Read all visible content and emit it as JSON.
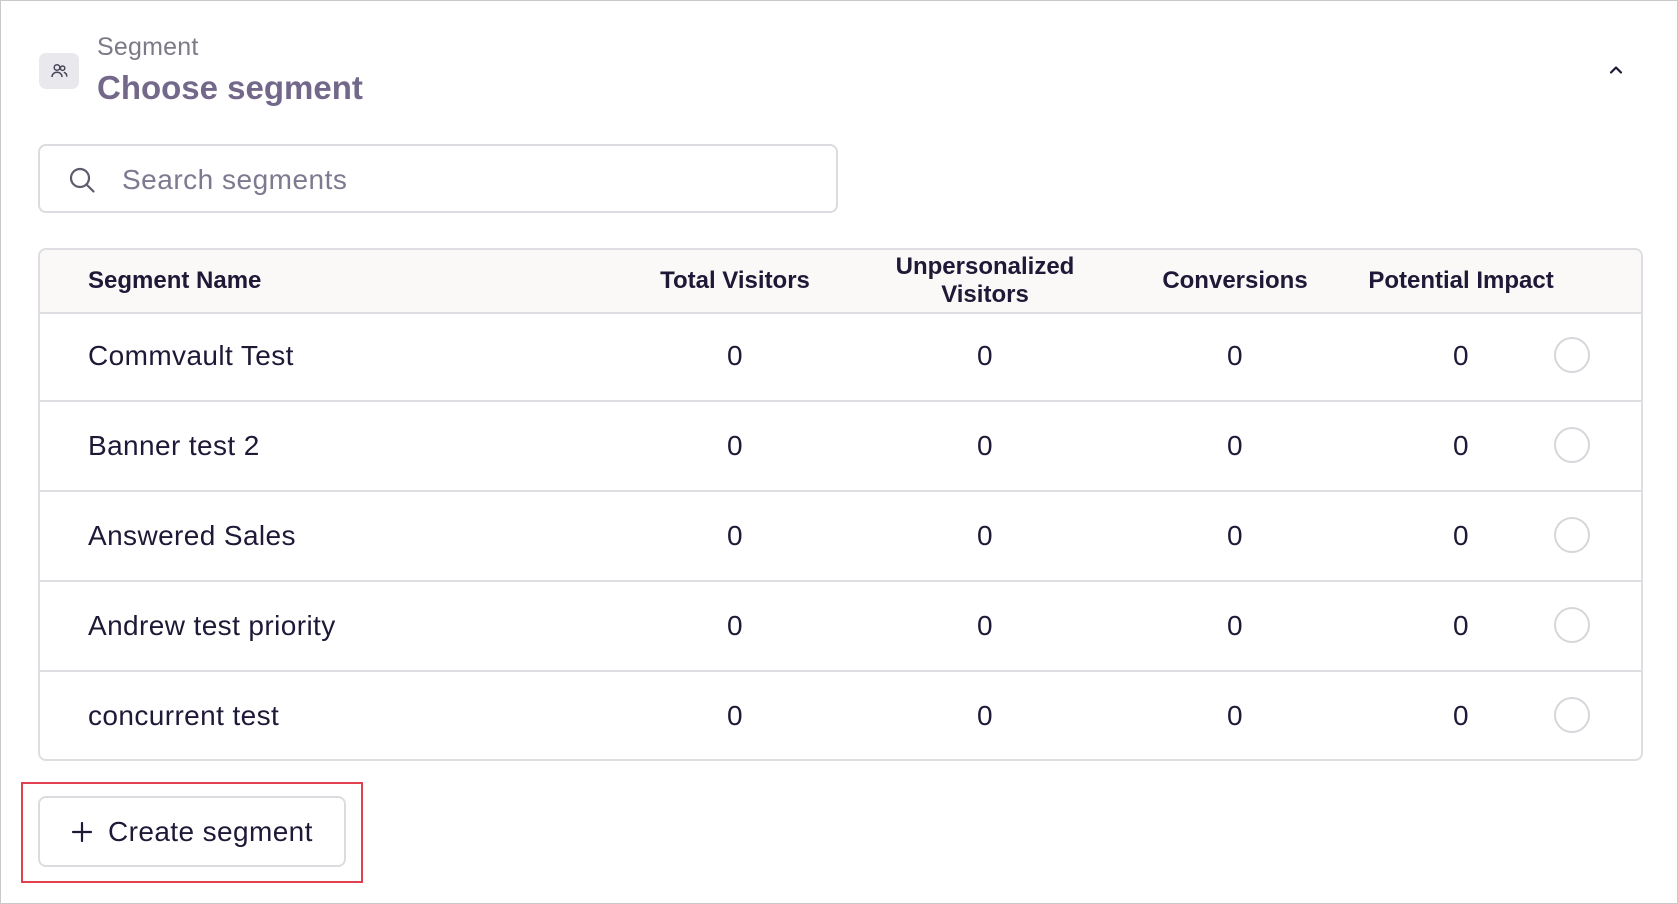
{
  "header": {
    "subtitle": "Segment",
    "title": "Choose segment",
    "icon": "users-icon",
    "collapse_icon": "chevron-up-icon"
  },
  "search": {
    "placeholder": "Search segments",
    "value": "",
    "icon": "search-icon"
  },
  "table": {
    "columns": [
      "Segment Name",
      "Total Visitors",
      "Unpersonalized Visitors",
      "Conversions",
      "Potential Impact"
    ],
    "rows": [
      {
        "name": "Commvault Test",
        "total_visitors": "0",
        "unpersonalized_visitors": "0",
        "conversions": "0",
        "potential_impact": "0",
        "selected": false
      },
      {
        "name": "Banner test 2",
        "total_visitors": "0",
        "unpersonalized_visitors": "0",
        "conversions": "0",
        "potential_impact": "0",
        "selected": false
      },
      {
        "name": "Answered Sales",
        "total_visitors": "0",
        "unpersonalized_visitors": "0",
        "conversions": "0",
        "potential_impact": "0",
        "selected": false
      },
      {
        "name": "Andrew test priority",
        "total_visitors": "0",
        "unpersonalized_visitors": "0",
        "conversions": "0",
        "potential_impact": "0",
        "selected": false
      },
      {
        "name": "concurrent test",
        "total_visitors": "0",
        "unpersonalized_visitors": "0",
        "conversions": "0",
        "potential_impact": "0",
        "selected": false
      }
    ]
  },
  "create_button": {
    "label": "Create segment",
    "icon": "plus-icon"
  },
  "colors": {
    "title": "#73688a",
    "text": "#1f1836",
    "highlight": "#e0404f",
    "border": "#dedde2"
  }
}
